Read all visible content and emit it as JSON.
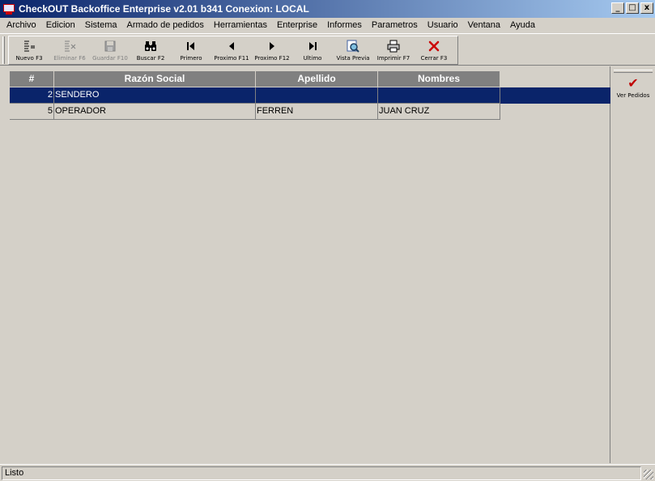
{
  "window": {
    "title": "CheckOUT Backoffice Enterprise v2.01 b341 Conexion: LOCAL",
    "buttons": [
      "_",
      "□",
      "x"
    ]
  },
  "menu": [
    "Archivo",
    "Edicion",
    "Sistema",
    "Armado de pedidos",
    "Herramientas",
    "Enterprise",
    "Informes",
    "Parametros",
    "Usuario",
    "Ventana",
    "Ayuda"
  ],
  "toolbar": [
    {
      "label": "Nuevo F3",
      "icon": "new-icon",
      "glyph": "☰",
      "enabled": true
    },
    {
      "label": "Eliminar F6",
      "icon": "delete-icon",
      "glyph": "☰",
      "enabled": false
    },
    {
      "label": "Guardar F10",
      "icon": "save-icon",
      "glyph": "▣",
      "enabled": false
    },
    {
      "label": "Buscar F2",
      "icon": "binoculars-icon",
      "glyph": "⚇",
      "enabled": true
    },
    {
      "label": "Primero",
      "icon": "first-icon",
      "glyph": "⏮",
      "enabled": true
    },
    {
      "label": "Proximo F11",
      "icon": "previous-icon",
      "glyph": "◀",
      "enabled": true
    },
    {
      "label": "Proximo F12",
      "icon": "next-icon",
      "glyph": "▶",
      "enabled": true
    },
    {
      "label": "Ultimo",
      "icon": "last-icon",
      "glyph": "⏭",
      "enabled": true
    },
    {
      "label": "Vista Previa",
      "icon": "preview-icon",
      "glyph": "🔍",
      "enabled": true
    },
    {
      "label": "Imprimir F7",
      "icon": "print-icon",
      "glyph": "🖶",
      "enabled": true
    },
    {
      "label": "Cerrar F3",
      "icon": "close-icon",
      "glyph": "✕",
      "enabled": true
    }
  ],
  "grid": {
    "columns": [
      "#",
      "Razón Social",
      "Apellido",
      "Nombres"
    ],
    "rows": [
      {
        "num": "2",
        "razon": "SENDERO",
        "apellido": "",
        "nombres": "",
        "selected": true
      },
      {
        "num": "5",
        "razon": "OPERADOR",
        "apellido": "FERREN",
        "nombres": "JUAN CRUZ",
        "selected": false
      }
    ]
  },
  "side_panel": {
    "button_label": "Ver Pedidos",
    "button_glyph": "✔"
  },
  "status": {
    "text": "Listo"
  },
  "colors": {
    "selection": "#0a246a",
    "header_bg": "#808080",
    "close_red": "#cc0000"
  }
}
